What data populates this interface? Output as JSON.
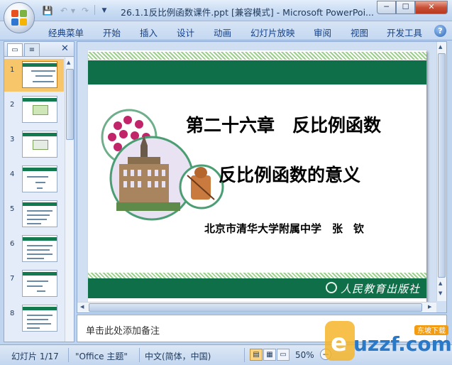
{
  "window": {
    "title": "26.1.1反比例函数课件.ppt [兼容模式] - Microsoft PowerPoi...",
    "min": "─",
    "max": "☐",
    "close": "✕"
  },
  "quick_access": {
    "save_icon": "save-icon",
    "undo_icon": "undo-icon",
    "redo_icon": "redo-icon"
  },
  "ribbon": {
    "tabs": [
      "经典菜单",
      "开始",
      "插入",
      "设计",
      "动画",
      "幻灯片放映",
      "审阅",
      "视图",
      "开发工具"
    ],
    "help": "?"
  },
  "thumbnails": {
    "numbers": [
      "1",
      "2",
      "3",
      "4",
      "5",
      "6",
      "7",
      "8"
    ],
    "selected": 1
  },
  "slide": {
    "title": "第二十六章　反比例函数",
    "subtitle": "反比例函数的意义",
    "author": "北京市清华大学附属中学　张　钦",
    "publisher": "人民教育出版社",
    "colors": {
      "green": "#0f6f49",
      "stripe": "#9ccf8e"
    }
  },
  "notes": {
    "placeholder": "单击此处添加备注"
  },
  "status": {
    "slide": "幻灯片 1/17",
    "theme": "\"Office 主题\"",
    "language": "中文(简体，中国)",
    "zoom": "50%"
  },
  "watermark": {
    "text": "uzzf.com",
    "tag": "东坡下载"
  }
}
